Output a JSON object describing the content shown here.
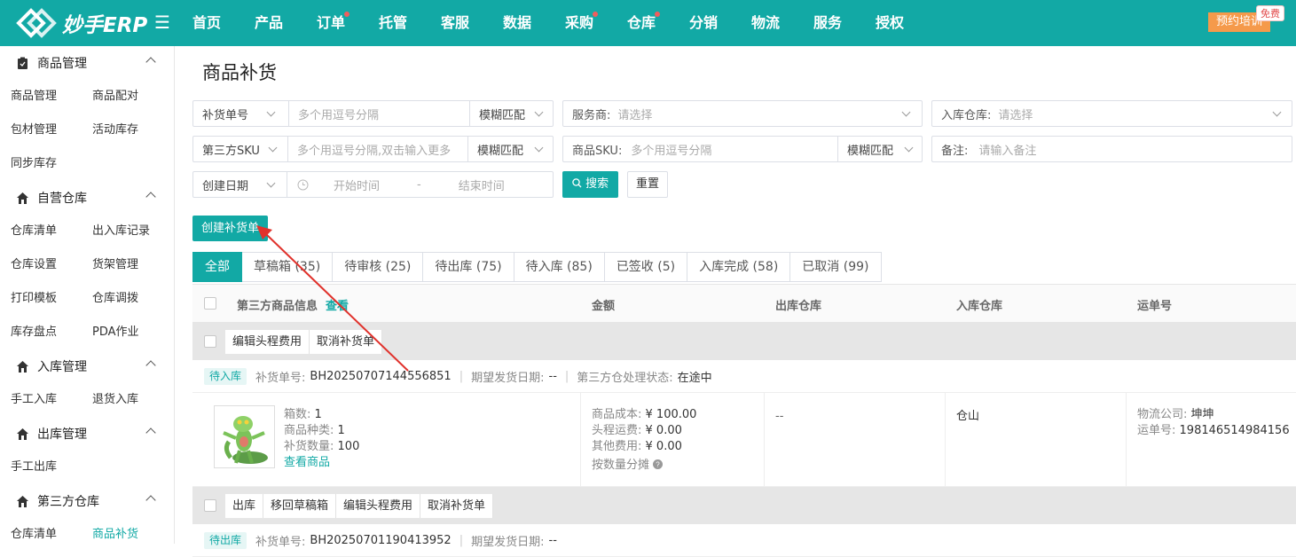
{
  "app": {
    "logo_text": "妙手ERP",
    "training_label": "预约培训",
    "free_badge": "免费"
  },
  "nav": [
    {
      "label": "首页",
      "dot": false
    },
    {
      "label": "产品",
      "dot": false
    },
    {
      "label": "订单",
      "dot": true
    },
    {
      "label": "托管",
      "dot": false
    },
    {
      "label": "客服",
      "dot": false
    },
    {
      "label": "数据",
      "dot": false
    },
    {
      "label": "采购",
      "dot": true
    },
    {
      "label": "仓库",
      "dot": true
    },
    {
      "label": "分销",
      "dot": false
    },
    {
      "label": "物流",
      "dot": false
    },
    {
      "label": "服务",
      "dot": false
    },
    {
      "label": "授权",
      "dot": false
    }
  ],
  "sidebar": {
    "groups": [
      {
        "title": "商品管理",
        "icon": "clipboard-icon",
        "items": [
          "商品管理",
          "商品配对",
          "包材管理",
          "活动库存",
          "同步库存"
        ]
      },
      {
        "title": "自营仓库",
        "icon": "house-icon",
        "items": [
          "仓库清单",
          "出入库记录",
          "仓库设置",
          "货架管理",
          "打印模板",
          "仓库调拨",
          "库存盘点",
          "PDA作业"
        ]
      },
      {
        "title": "入库管理",
        "icon": "house-icon",
        "items": [
          "手工入库",
          "退货入库"
        ]
      },
      {
        "title": "出库管理",
        "icon": "house-icon",
        "items": [
          "手工出库"
        ]
      },
      {
        "title": "第三方仓库",
        "icon": "house-icon",
        "items": [
          "仓库清单",
          "商品补货"
        ]
      }
    ],
    "active_item": "商品补货"
  },
  "page": {
    "title": "商品补货"
  },
  "filters": {
    "row1": {
      "order_field": "补货单号",
      "order_placeholder": "多个用逗号分隔",
      "order_match": "模糊匹配",
      "provider_label": "服务商:",
      "provider_placeholder": "请选择",
      "warehouse_label": "入库仓库:",
      "warehouse_placeholder": "请选择"
    },
    "row2": {
      "sku_field": "第三方SKU",
      "sku_placeholder": "多个用逗号分隔,双击输入更多",
      "sku_match": "模糊匹配",
      "product_sku_label": "商品SKU:",
      "product_sku_placeholder": "多个用逗号分隔",
      "product_sku_match": "模糊匹配",
      "remark_label": "备注:",
      "remark_placeholder": "请输入备注"
    },
    "row3": {
      "date_field": "创建日期",
      "start_placeholder": "开始时间",
      "range_sep": "-",
      "end_placeholder": "结束时间"
    },
    "search_label": "搜索",
    "reset_label": "重置"
  },
  "create_button_label": "创建补货单",
  "tabs": [
    {
      "label": "全部",
      "active": true
    },
    {
      "label": "草稿箱 (35)",
      "active": false
    },
    {
      "label": "待审核 (25)",
      "active": false
    },
    {
      "label": "待出库 (75)",
      "active": false
    },
    {
      "label": "待入库 (85)",
      "active": false
    },
    {
      "label": "已签收 (5)",
      "active": false
    },
    {
      "label": "入库完成 (58)",
      "active": false
    },
    {
      "label": "已取消 (99)",
      "active": false
    }
  ],
  "table": {
    "headers": {
      "product_info": "第三方商品信息",
      "view_link": "查看",
      "amount": "金额",
      "out_warehouse": "出库仓库",
      "in_warehouse": "入库仓库",
      "tracking": "运单号"
    }
  },
  "orders": [
    {
      "actions": [
        "编辑头程费用",
        "取消补货单"
      ],
      "status": "待入库",
      "order_no_label": "补货单号:",
      "order_no": "BH20250707144556851",
      "expected_label": "期望发货日期:",
      "expected": "--",
      "third_status_label": "第三方仓处理状态:",
      "third_status": "在途中",
      "boxes_label": "箱数:",
      "boxes": "1",
      "types_label": "商品种类:",
      "types": "1",
      "qty_label": "补货数量:",
      "qty": "100",
      "view_goods": "查看商品",
      "cost_label": "商品成本:",
      "cost": "¥ 100.00",
      "freight_label": "头程运费:",
      "freight": "¥ 0.00",
      "other_label": "其他费用:",
      "other": "¥ 0.00",
      "allocation": "按数量分摊",
      "out_warehouse": "--",
      "in_warehouse": "仓山",
      "carrier_label": "物流公司:",
      "carrier": "坤坤",
      "tracking_label": "运单号:",
      "tracking": "198146514984156"
    },
    {
      "actions": [
        "出库",
        "移回草稿箱",
        "编辑头程费用",
        "取消补货单"
      ],
      "status": "待出库",
      "order_no_label": "补货单号:",
      "order_no": "BH20250701190413952",
      "expected_label": "期望发货日期:",
      "expected": "--"
    }
  ]
}
